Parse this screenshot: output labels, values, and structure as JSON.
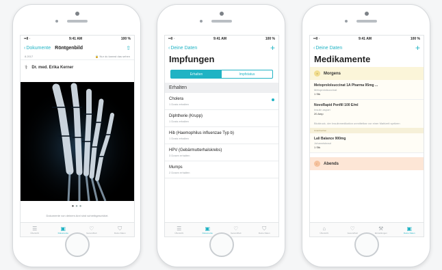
{
  "colors": {
    "accent": "#20b3c4",
    "morning_band": "#fbf5d9",
    "evening_band": "#fde6d6"
  },
  "status": {
    "carrier": "••ll ᐧ",
    "time": "9:41 AM",
    "battery": "100 %"
  },
  "screen1": {
    "back_label": "Dokumente",
    "title": "Röntgenbild",
    "meta_left": "8.2017",
    "meta_right": "Nur du kannst das sehen",
    "doctor": "Dr. med. Erika Kerner",
    "caption": "Dokumente von deinem Arzt sind schreibgeschützt."
  },
  "screen2": {
    "back_label": "Deine Daten",
    "title": "Impfungen",
    "segments": [
      "Erhalten",
      "Impfstatus"
    ],
    "section": "Erhalten",
    "items": [
      {
        "name": "Cholera",
        "sub": "1 Dosis erhalten"
      },
      {
        "name": "Diphtherie (Krupp)",
        "sub": "1 Dosis erhalten"
      },
      {
        "name": "Hib (Haemophilus influenzae Typ b)",
        "sub": "1 Dosis erhalten"
      },
      {
        "name": "HPV (Gebärmutterhalskrebs)",
        "sub": "3 Dosen erhalten"
      },
      {
        "name": "Mumps",
        "sub": "2 Dosen erhalten"
      }
    ]
  },
  "screen3": {
    "back_label": "Deine Daten",
    "title": "Medikamente",
    "morning": "Morgens",
    "evening": "Abends",
    "meds": [
      {
        "name": "Metoprololsuccinat 1A Pharma 95mg ...",
        "sub": "Metoprololsuccinat",
        "qty": "1 Stk"
      },
      {
        "name": "NovoRapid Penfill 100 E/ml",
        "sub": "Insulin aspart",
        "qty": "20 Amp"
      }
    ],
    "note": "Blutdruck- der Insulinmedikation unmittelbar vor einer Mahlzeit spritzen",
    "separator": "Unterbrechen",
    "meds2": [
      {
        "name": "Lali Balance 900mg",
        "sub": "Johanniskraut",
        "qty": "1 Stk"
      }
    ]
  },
  "tabs": [
    "Übersicht",
    "Dokumente",
    "Gesundheit",
    "Deine Daten",
    "Einstellungen"
  ]
}
